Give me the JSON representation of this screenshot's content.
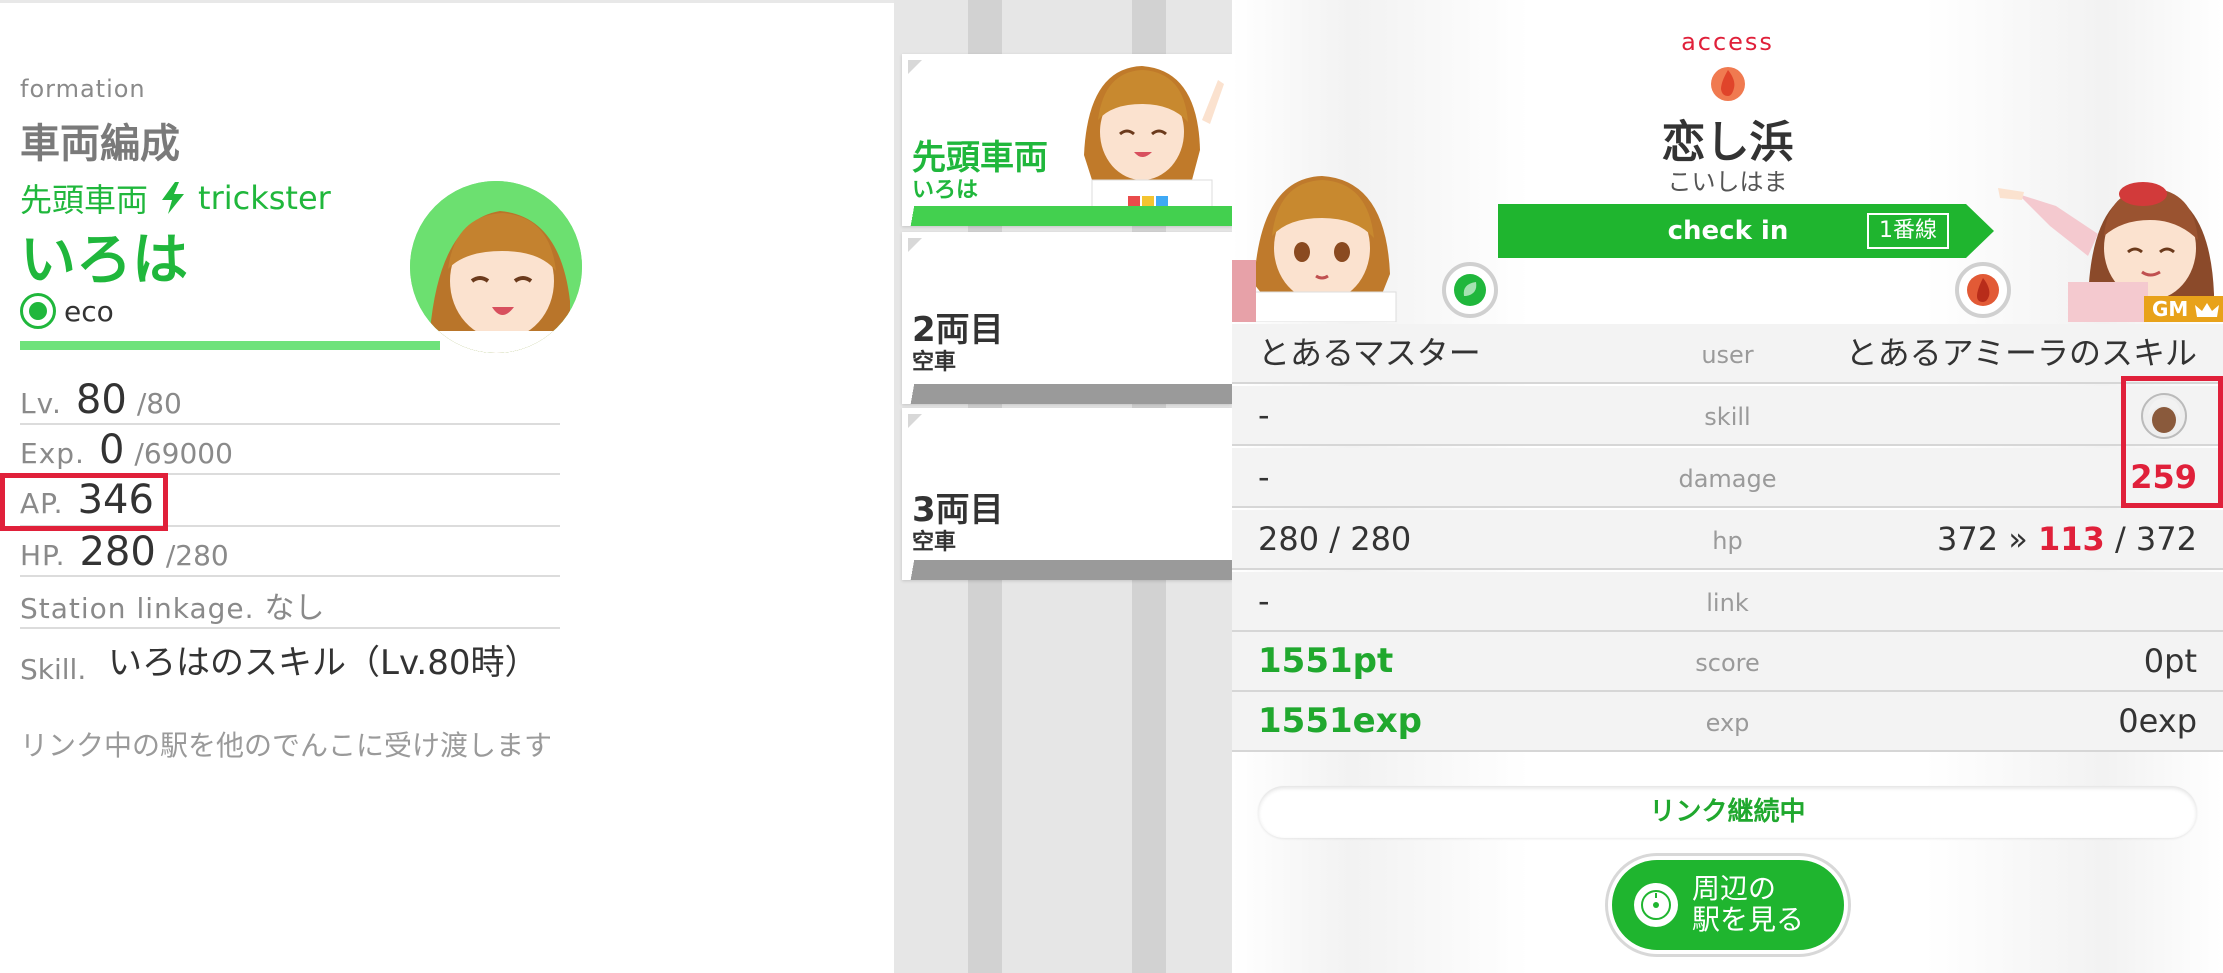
{
  "formation": {
    "subtitle": "formation",
    "title": "車両編成",
    "position": "先頭車両",
    "type": "trickster",
    "name": "いろは",
    "attribute": "eco",
    "stats": {
      "lv_label": "Lv.",
      "lv": "80",
      "lv_max": "/80",
      "exp_label": "Exp.",
      "exp": "0",
      "exp_max": "/69000",
      "ap_label": "AP.",
      "ap": "346",
      "hp_label": "HP.",
      "hp": "280",
      "hp_max": "/280",
      "link_label": "Station linkage.",
      "link_value": "なし"
    },
    "skill_label": "Skill.",
    "skill_name": "いろはのスキル（Lv.80時）",
    "skill_desc": "リンク中の駅を他のでんこに受け渡します"
  },
  "cars": [
    {
      "title": "先頭車両",
      "sub": "いろは"
    },
    {
      "title": "2両目",
      "sub": "空車"
    },
    {
      "title": "3両目",
      "sub": "空車"
    }
  ],
  "access": {
    "label": "access",
    "station": "恋し浜",
    "kana": "こいしはま",
    "checkin": "check in",
    "track": "1番線",
    "gm_badge": "GM",
    "rows": {
      "user": {
        "left": "とあるマスター",
        "mid": "user",
        "right": "とあるアミーラのスキル"
      },
      "skill": {
        "left": "-",
        "mid": "skill"
      },
      "damage": {
        "left": "-",
        "mid": "damage",
        "right": "259"
      },
      "hp": {
        "left": "280 / 280",
        "mid": "hp",
        "right_a": "372 »",
        "right_b": "113",
        "right_c": "/ 372"
      },
      "link": {
        "left": "-",
        "mid": "link"
      },
      "score": {
        "left": "1551pt",
        "mid": "score",
        "right": "0pt"
      },
      "exp": {
        "left": "1551exp",
        "mid": "exp",
        "right": "0exp"
      }
    },
    "status": "リンク継続中",
    "nearby_button": "周辺の\n駅を見る"
  },
  "colors": {
    "accent_green": "#20b73c",
    "accent_red": "#e0203a",
    "gm_gold": "#e8a21a"
  }
}
